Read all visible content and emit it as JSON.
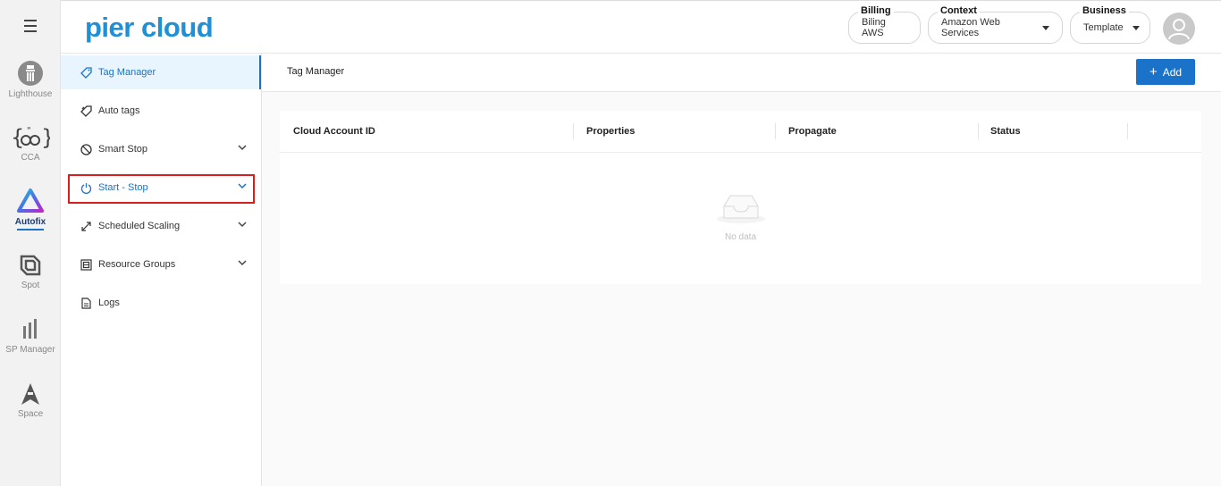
{
  "rail": {
    "items": [
      {
        "label": "Lighthouse"
      },
      {
        "label": "CCA"
      },
      {
        "label": "Autofix"
      },
      {
        "label": "Spot"
      },
      {
        "label": "SP Manager"
      },
      {
        "label": "Space"
      }
    ]
  },
  "header": {
    "logo": "pier cloud",
    "billing": {
      "label": "Billing",
      "value": "Biling AWS"
    },
    "context": {
      "label": "Context",
      "value": "Amazon Web Services"
    },
    "business": {
      "label": "Business",
      "value": "Template"
    }
  },
  "submenu": {
    "items": [
      {
        "label": "Tag Manager"
      },
      {
        "label": "Auto tags"
      },
      {
        "label": "Smart Stop"
      },
      {
        "label": "Start - Stop"
      },
      {
        "label": "Scheduled Scaling"
      },
      {
        "label": "Resource Groups"
      },
      {
        "label": "Logs"
      }
    ]
  },
  "main": {
    "title": "Tag Manager",
    "add_label": "Add",
    "table": {
      "columns": [
        "Cloud Account ID",
        "Properties",
        "Propagate",
        "Status"
      ],
      "empty_text": "No data"
    }
  },
  "colors": {
    "accent": "#1a73c8",
    "highlight": "#d62020",
    "logo": "#1f8fd6"
  }
}
